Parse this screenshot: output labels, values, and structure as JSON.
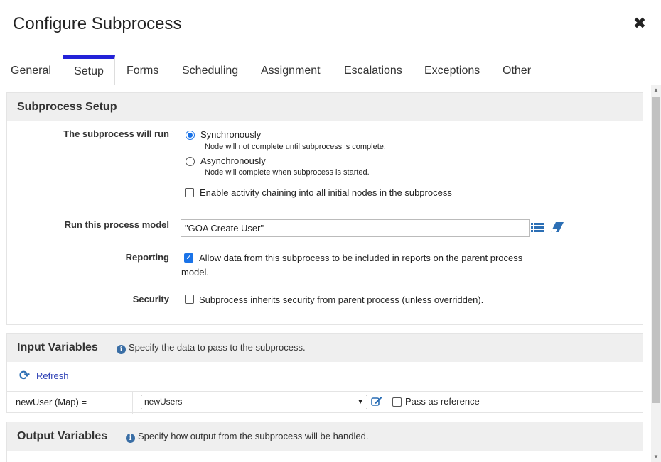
{
  "dialog": {
    "title": "Configure Subprocess",
    "close_glyph": "✖"
  },
  "tabs": [
    {
      "label": "General"
    },
    {
      "label": "Setup",
      "active": true
    },
    {
      "label": "Forms"
    },
    {
      "label": "Scheduling"
    },
    {
      "label": "Assignment"
    },
    {
      "label": "Escalations"
    },
    {
      "label": "Exceptions"
    },
    {
      "label": "Other"
    }
  ],
  "setup": {
    "header": "Subprocess Setup",
    "run_label": "The subprocess will run",
    "sync_label": "Synchronously",
    "sync_desc": "Node will not complete until subprocess is complete.",
    "async_label": "Asynchronously",
    "async_desc": "Node will complete when subprocess is started.",
    "chaining_label": "Enable activity chaining into all initial nodes in the subprocess",
    "model_label": "Run this process model",
    "model_value": "\"GOA  Create User\"",
    "reporting_label": "Reporting",
    "reporting_text_1": "Allow data from this subprocess to be included in reports on the parent process",
    "reporting_text_2": "model.",
    "security_label": "Security",
    "security_text": "Subprocess inherits security from parent process (unless overridden).",
    "list_icon": "list-icon",
    "eraser_icon": "eraser-icon"
  },
  "input_vars": {
    "header": "Input Variables",
    "note": "Specify the data to pass to the subprocess.",
    "refresh_label": "Refresh",
    "rows": [
      {
        "name": "newUser (Map) =",
        "value": "newUsers",
        "pass_ref_label": "Pass as reference"
      }
    ]
  },
  "output_vars": {
    "header": "Output Variables",
    "note": "Specify how output from the subprocess will be handled."
  },
  "colors": {
    "accent": "#2322d8",
    "checkbox": "#1a73e8",
    "header_bg": "#efefef"
  }
}
